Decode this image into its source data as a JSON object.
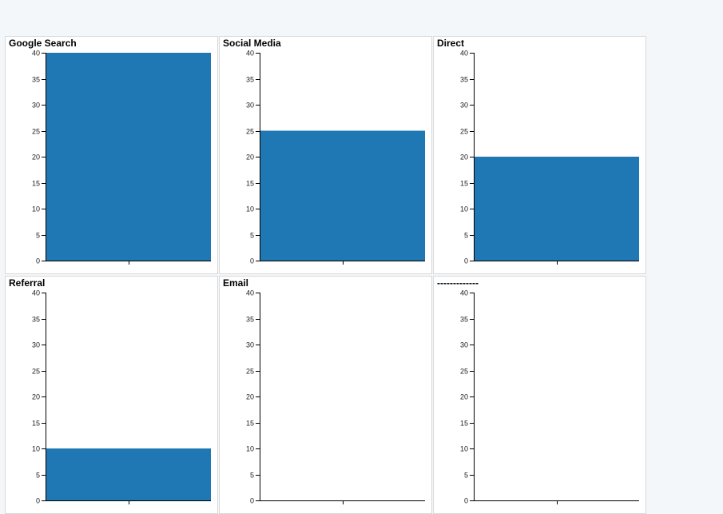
{
  "chart_data": {
    "type": "bar",
    "facets": [
      {
        "title": "Google Search",
        "value": 40
      },
      {
        "title": "Social Media",
        "value": 25
      },
      {
        "title": "Direct",
        "value": 20
      },
      {
        "title": "Referral",
        "value": 10
      },
      {
        "title": "Email",
        "value": null
      },
      {
        "title": "-------------",
        "value": null
      }
    ],
    "ylim": [
      0,
      40
    ],
    "yticks": [
      0,
      5,
      10,
      15,
      20,
      25,
      30,
      35,
      40
    ],
    "bar_color": "#1f77b4",
    "grid": false
  }
}
